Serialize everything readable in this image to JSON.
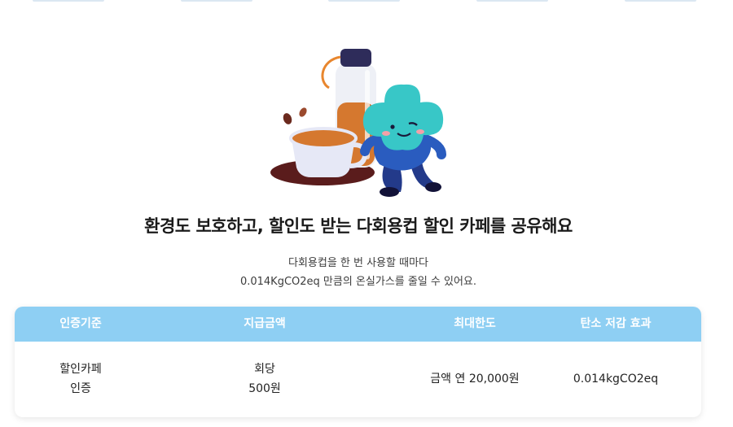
{
  "headline": "환경도 보호하고, 할인도 받는 다회용컵 할인 카페를 공유해요",
  "subtext": {
    "line1": "다회용컵을 한 번 사용할 때마다",
    "line2": "0.014KgCO2eq 만큼의 온실가스를 줄일 수 있어요."
  },
  "table": {
    "headers": [
      "인증기준",
      "지급금액",
      "최대한도",
      "탄소 저감 효과"
    ],
    "row": {
      "criteria_line1": "할인카페",
      "criteria_line2": "인증",
      "amount_line1": "회당",
      "amount_line2": "500원",
      "limit": "금액 연 20,000원",
      "carbon": "0.014kgCO2eq"
    }
  },
  "colors": {
    "header_bg": "#8ecff3",
    "character": "#38c7c7",
    "coffee": "#d5782f"
  }
}
